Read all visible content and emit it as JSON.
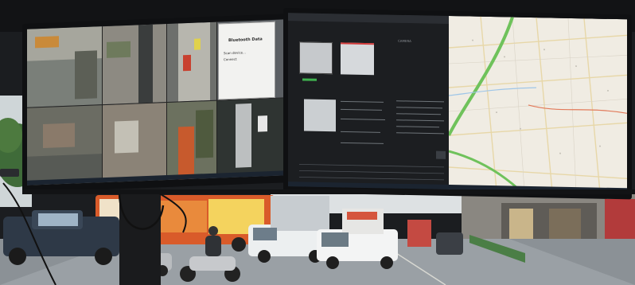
{
  "scene": {
    "description_free": true,
    "colors": {
      "ceiling": "#15171a",
      "bezel": "#0e0f11",
      "street": "#8f969c",
      "sky": "#d9dde0",
      "map_bg": "#f1ede4",
      "map_green": "#6fc25b",
      "app_bg": "#1f2124",
      "bus_orange": "#e0622c"
    }
  },
  "left_monitor": {
    "dialog": {
      "title": "Bluetooth Data",
      "line1": "Scan device...",
      "line2": "Connect"
    }
  },
  "right_monitor": {
    "app": {
      "panel_label": "CAMERA"
    }
  }
}
